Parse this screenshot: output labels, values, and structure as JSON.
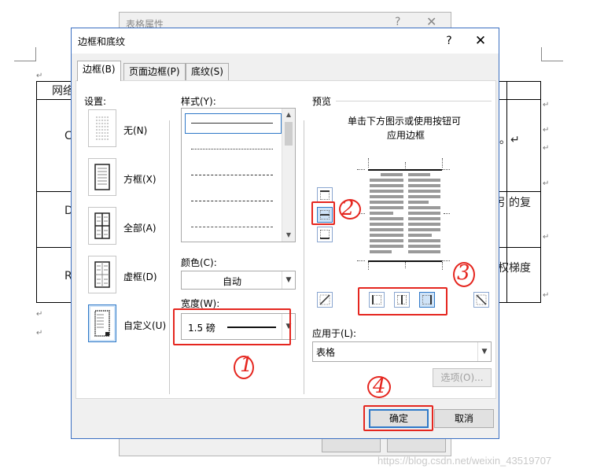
{
  "background_document": {
    "cells": [
      "网络",
      "C",
      "D",
      "R",
      "。↵",
      "引的复",
      "权梯度"
    ],
    "para_mark": "↵"
  },
  "table_properties_dialog": {
    "title": "表格属性",
    "help": "?",
    "close": "✕"
  },
  "dialog": {
    "title": "边框和底纹",
    "help": "?",
    "close": "✕",
    "tabs": [
      "边框(B)",
      "页面边框(P)",
      "底纹(S)"
    ],
    "settings": {
      "label": "设置:",
      "items": [
        "无(N)",
        "方框(X)",
        "全部(A)",
        "虚框(D)",
        "自定义(U)"
      ],
      "selected": "自定义(U)"
    },
    "style": {
      "label": "样式(Y):"
    },
    "color": {
      "label": "颜色(C):",
      "value": "自动"
    },
    "width": {
      "label": "宽度(W):",
      "value": "1.5 磅"
    },
    "preview": {
      "label": "预览",
      "instruction_line1": "单击下方图示或使用按钮可",
      "instruction_line2": "应用边框"
    },
    "apply_to": {
      "label": "应用于(L):",
      "value": "表格"
    },
    "options_button": "选项(O)...",
    "ok_button": "确定",
    "cancel_button": "取消"
  },
  "annotations": [
    "1",
    "2",
    "3",
    "4"
  ],
  "watermark": "https://blog.csdn.net/weixin_43519707",
  "colors": {
    "accent": "#2f79c8",
    "annotation": "#e5261f",
    "dialog_bg": "#f0f0f0"
  }
}
